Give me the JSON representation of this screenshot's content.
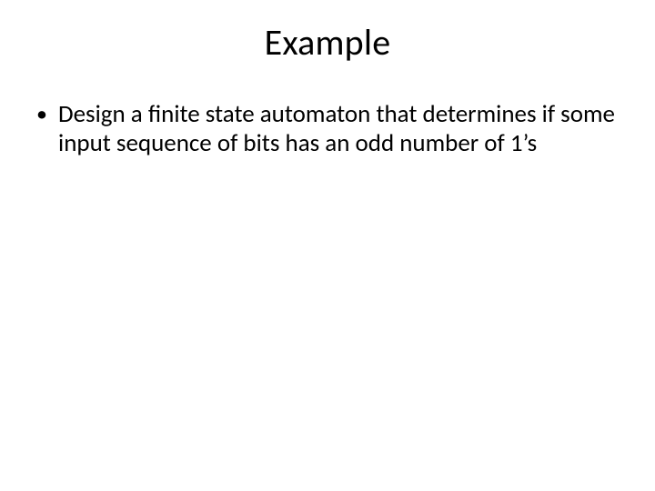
{
  "slide": {
    "title": "Example",
    "bullets": [
      "Design a finite state automaton that determines if some input sequence of bits has an odd number of 1’s"
    ]
  }
}
